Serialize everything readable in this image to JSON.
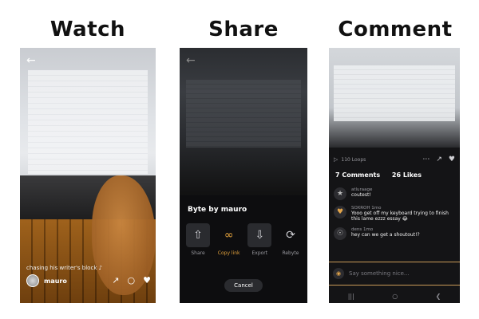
{
  "headings": {
    "watch": "Watch",
    "share": "Share",
    "comment": "Comment"
  },
  "watch": {
    "back_icon": "back-arrow-icon",
    "caption": "chasing his writer's block ♪",
    "username": "mauro",
    "actions": {
      "share_icon": "share-icon",
      "comment_icon": "comment-icon",
      "like_icon": "heart-icon"
    }
  },
  "share": {
    "back_icon": "back-arrow-icon",
    "title": "Byte by mauro",
    "options": [
      {
        "label": "Share",
        "icon": "share-upload-icon"
      },
      {
        "label": "Copy link",
        "icon": "link-icon",
        "highlight": "#e2a13c"
      },
      {
        "label": "Export",
        "icon": "download-icon"
      },
      {
        "label": "Rebyte",
        "icon": "rebyte-icon"
      }
    ],
    "cancel": "Cancel"
  },
  "comment": {
    "loops": "110 Loops",
    "comments_count": "7 Comments",
    "likes_count": "26 Likes",
    "comments": [
      {
        "user": "atluraage",
        "time": "",
        "text": "coutest!"
      },
      {
        "user": "SOXROH",
        "time": "1mo",
        "text": "Yooo get off my keyboard trying to finish this lame ezzz essay 😂"
      },
      {
        "user": "dens",
        "time": "1mo",
        "text": "hey can we get a shoutout!?"
      }
    ],
    "input_placeholder": "Say something nice...",
    "accent": "#c99a58"
  }
}
